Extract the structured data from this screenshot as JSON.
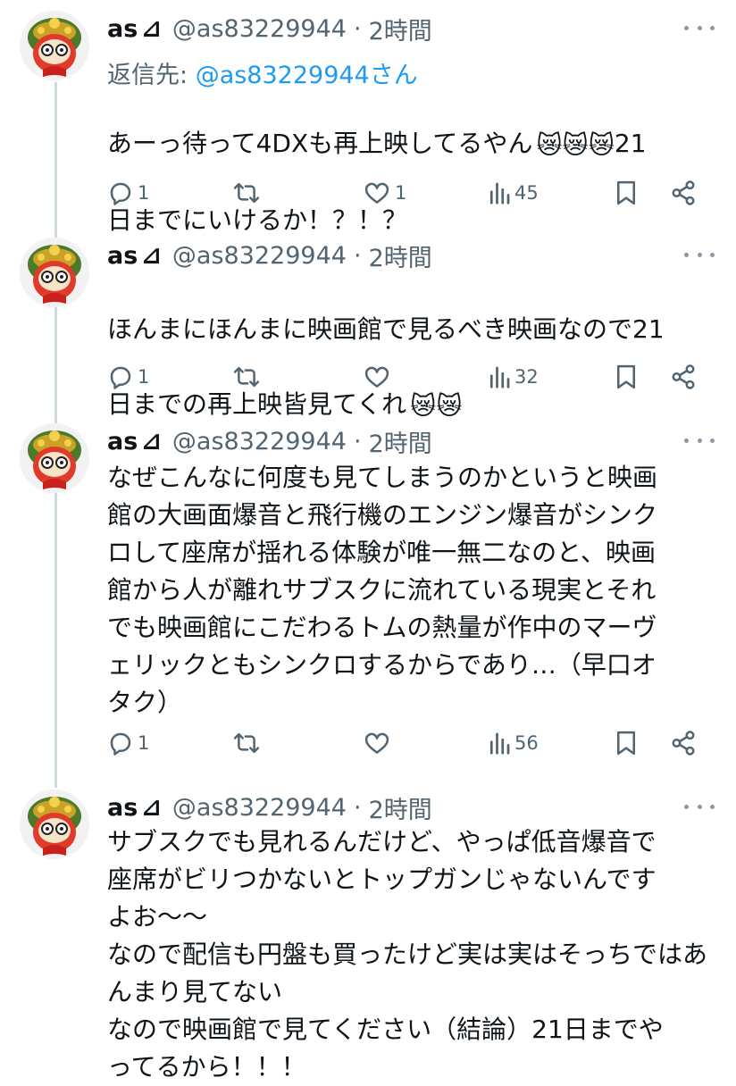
{
  "tweets": [
    {
      "name": "as",
      "badge": "⊿",
      "handle": "@as83229944",
      "separator": "·",
      "time": "2時間",
      "reply_prefix": "返信先: ",
      "reply_to": "@as83229944さん",
      "line1": "あーっ待って4DXも再上映してるやん",
      "emoji": "😿😿😿",
      "line1_tail": "21",
      "line2": "日までにいけるか！？！？",
      "replies": "1",
      "retweets": "",
      "likes": "1",
      "views": "45"
    },
    {
      "name": "as",
      "badge": "⊿",
      "handle": "@as83229944",
      "separator": "·",
      "time": "2時間",
      "line1": "ほんまにほんまに映画館で見るべき映画なので21",
      "line2": "日までの再上映皆見てくれ",
      "emoji": "😿😿",
      "replies": "1",
      "retweets": "",
      "likes": "",
      "views": "32"
    },
    {
      "name": "as",
      "badge": "⊿",
      "handle": "@as83229944",
      "separator": "·",
      "time": "2時間",
      "text": "なぜこんなに何度も見てしまうのかというと映画\n館の大画面爆音と飛行機のエンジン爆音がシンク\nロして座席が揺れる体験が唯一無二なのと、映画\n館から人が離れサブスクに流れている現実とそれ\nでも映画館にこだわるトムの熱量が作中のマーヴ\nェリックともシンクロするからであり…（早口オ\nタク）",
      "replies": "1",
      "retweets": "",
      "likes": "",
      "views": "56"
    },
    {
      "name": "as",
      "badge": "⊿",
      "handle": "@as83229944",
      "separator": "·",
      "time": "2時間",
      "text": "サブスクでも見れるんだけど、やっぱ低音爆音で\n座席がビリつかないとトップガンじゃないんです\nよお〜〜\nなので配信も円盤も買ったけど実は実はそっちではあ\nんまり見てない\nなので映画館で見てください（結論）21日までや\nってるから！！！"
    }
  ],
  "icons": {
    "reply": "reply-icon",
    "retweet": "retweet-icon",
    "like": "heart-icon",
    "views": "views-icon",
    "bookmark": "bookmark-icon",
    "share": "share-icon",
    "more": "more-icon",
    "avatar": "avatar-image",
    "emoji": "crying-cat-emoji"
  },
  "colors": {
    "text": "#0f1419",
    "secondary": "#536471",
    "link": "#1d9bf0",
    "thread_line": "#cfd9de"
  }
}
